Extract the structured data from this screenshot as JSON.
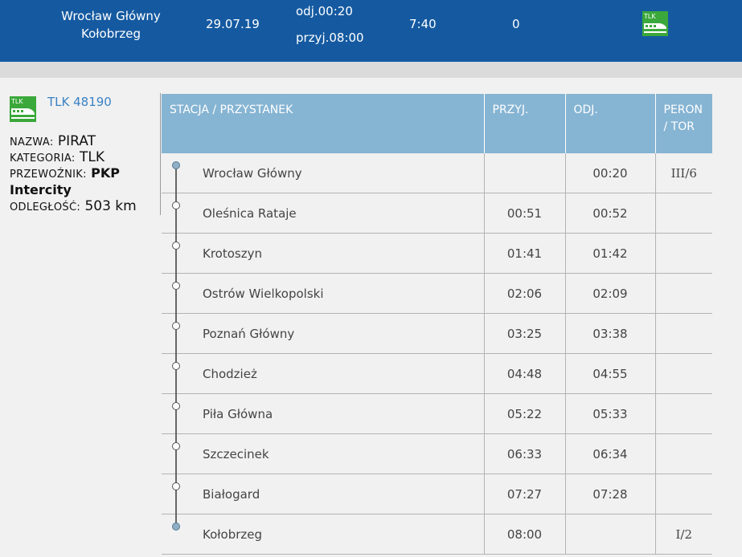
{
  "header": {
    "from_station": "Wrocław Główny",
    "to_station": "Kołobrzeg",
    "date": "29.07.19",
    "departure": "odj.00:20",
    "arrival": "przyj.08:00",
    "duration": "7:40",
    "changes": "0",
    "train_icon_label": "TLK"
  },
  "train": {
    "icon_label": "TLK",
    "link": "TLK 48190",
    "name_label": "NAZWA:",
    "name": "PIRAT",
    "category_label": "KATEGORIA:",
    "category": "TLK",
    "carrier_label": "PRZEWOŹNIK:",
    "carrier_1": "PKP",
    "carrier_2": "Intercity",
    "distance_label": "ODLEGŁOŚĆ:",
    "distance": "503 km"
  },
  "table": {
    "headers": {
      "station": "STACJA / PRZYSTANEK",
      "arrival": "PRZYJ.",
      "departure": "ODJ.",
      "platform_1": "PERON",
      "platform_2": "/ TOR"
    },
    "rows": [
      {
        "station": "Wrocław Główny",
        "arr": "",
        "dep": "00:20",
        "platform": "III/6"
      },
      {
        "station": "Oleśnica Rataje",
        "arr": "00:51",
        "dep": "00:52",
        "platform": ""
      },
      {
        "station": "Krotoszyn",
        "arr": "01:41",
        "dep": "01:42",
        "platform": ""
      },
      {
        "station": "Ostrów Wielkopolski",
        "arr": "02:06",
        "dep": "02:09",
        "platform": ""
      },
      {
        "station": "Poznań Główny",
        "arr": "03:25",
        "dep": "03:38",
        "platform": ""
      },
      {
        "station": "Chodzież",
        "arr": "04:48",
        "dep": "04:55",
        "platform": ""
      },
      {
        "station": "Piła Główna",
        "arr": "05:22",
        "dep": "05:33",
        "platform": ""
      },
      {
        "station": "Szczecinek",
        "arr": "06:33",
        "dep": "06:34",
        "platform": ""
      },
      {
        "station": "Białogard",
        "arr": "07:27",
        "dep": "07:28",
        "platform": ""
      },
      {
        "station": "Kołobrzeg",
        "arr": "08:00",
        "dep": "",
        "platform": "I/2"
      }
    ]
  },
  "colors": {
    "header_bg": "#155aa1",
    "table_header_bg": "#86b4d3",
    "link": "#3a82c4",
    "tlk_green": "#3aa83a"
  }
}
